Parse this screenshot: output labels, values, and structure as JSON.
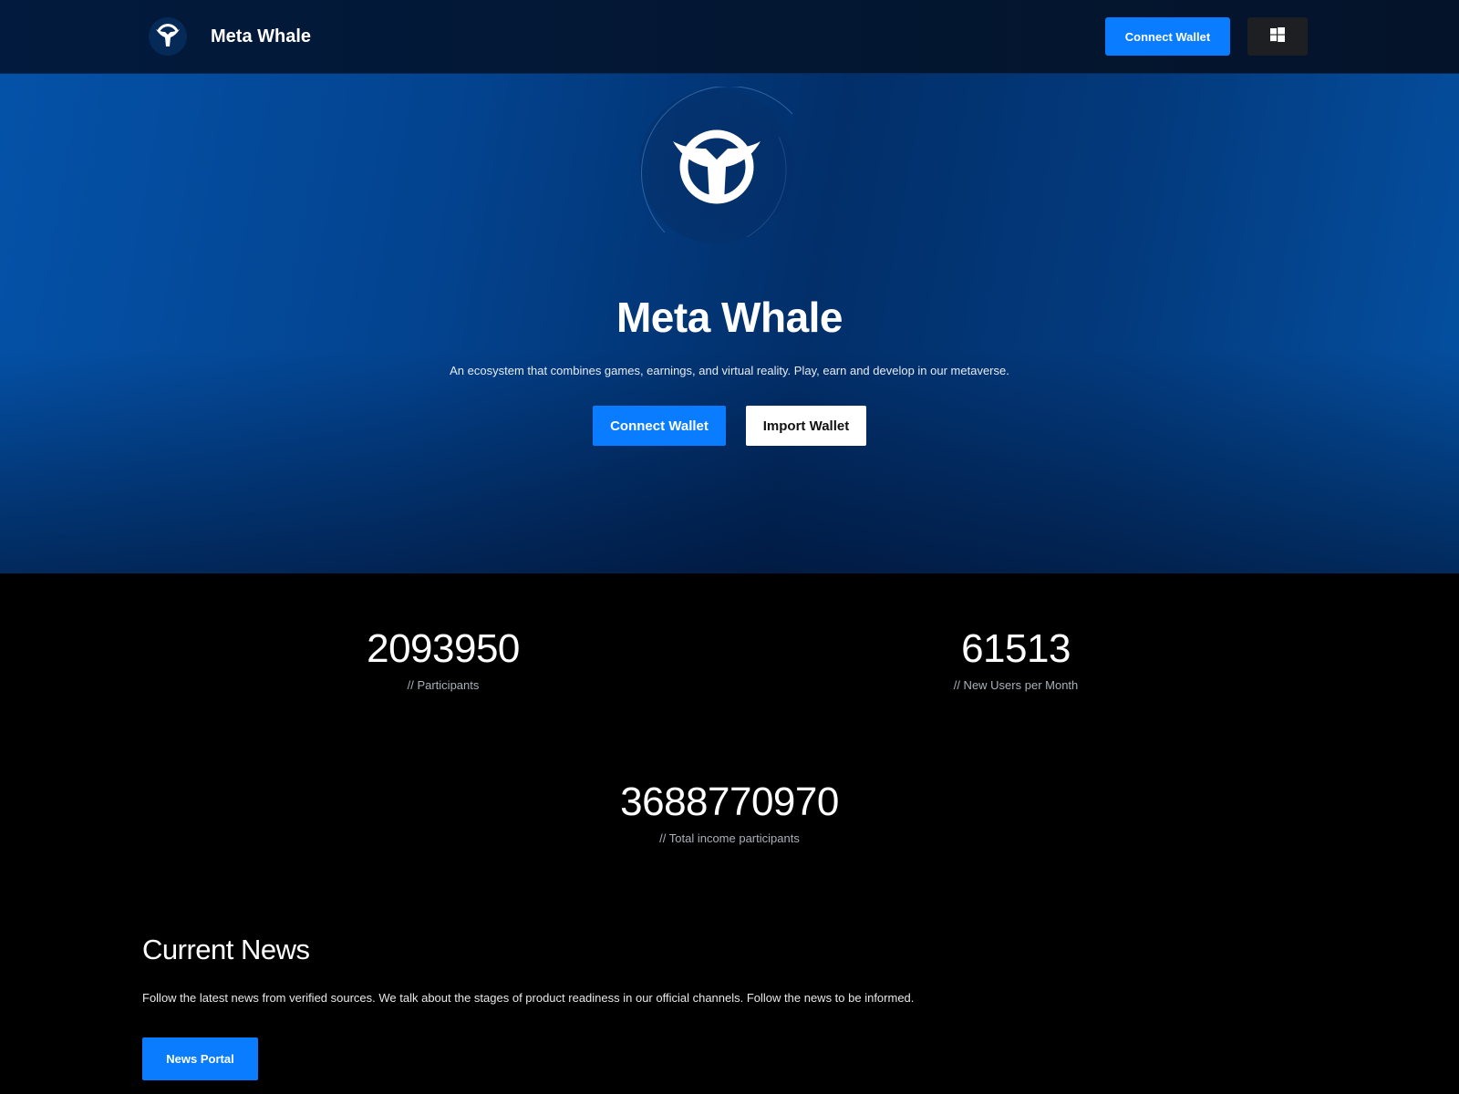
{
  "header": {
    "brand_name": "Meta Whale",
    "connect_label": "Connect Wallet",
    "os_icon": "windows-icon"
  },
  "hero": {
    "title": "Meta Whale",
    "subtitle": "An ecosystem that combines games, earnings, and virtual reality. Play, earn and develop in our metaverse.",
    "connect_label": "Connect Wallet",
    "import_label": "Import Wallet"
  },
  "stats": [
    {
      "value": "2093950",
      "label": "// Participants"
    },
    {
      "value": "61513",
      "label": "// New Users per Month"
    },
    {
      "value": "3688770970",
      "label": "// Total income participants"
    }
  ],
  "news": {
    "title": "Current News",
    "text": "Follow the latest news from verified sources. We talk about the stages of product readiness in our official channels. Follow the news to be informed.",
    "button_label": "News Portal"
  },
  "colors": {
    "accent": "#0a7cff",
    "page_background": "#000000",
    "hero_blue": "#03438f",
    "secondary_button": "#ffffff"
  }
}
